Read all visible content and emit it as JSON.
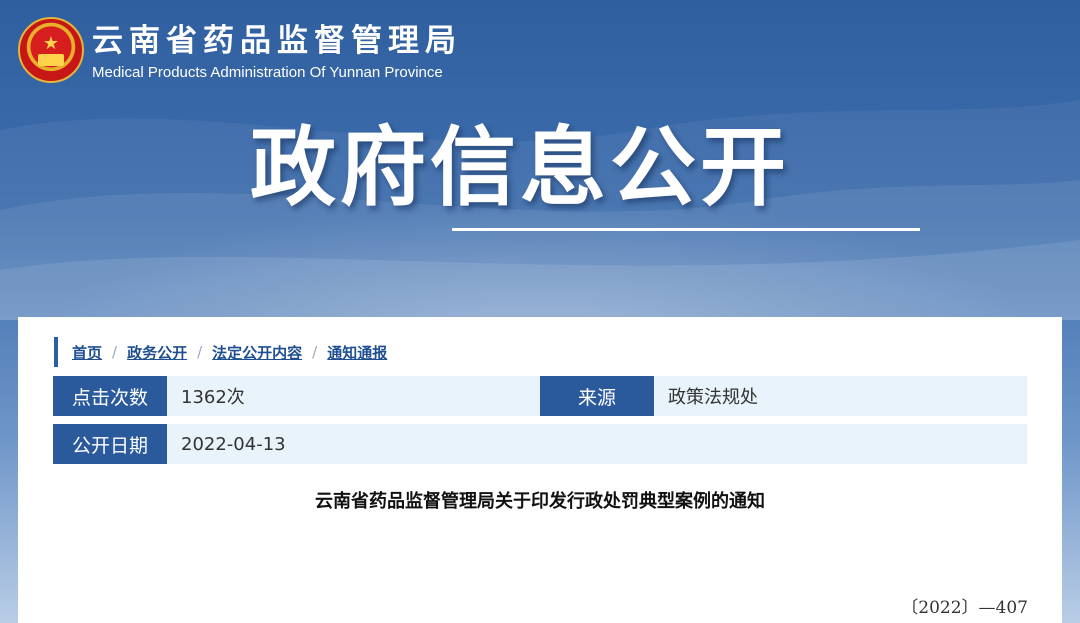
{
  "header": {
    "org_name_cn": "云南省药品监督管理局",
    "org_name_en": "Medical Products Administration Of Yunnan Province"
  },
  "banner": {
    "title": "政府信息公开"
  },
  "breadcrumb": {
    "items": [
      "首页",
      "政务公开",
      "法定公开内容",
      "通知通报"
    ],
    "separator": "/"
  },
  "info": {
    "clicks_label": "点击次数",
    "clicks_value": "1362次",
    "source_label": "来源",
    "source_value": "政策法规处",
    "date_label": "公开日期",
    "date_value": "2022-04-13"
  },
  "document": {
    "title": "云南省药品监督管理局关于印发行政处罚典型案例的通知",
    "number": "〔2022〕—407"
  },
  "colors": {
    "accent": "#2b5a9c",
    "row_bg": "#e8f3fc",
    "link": "#1f4f91"
  }
}
